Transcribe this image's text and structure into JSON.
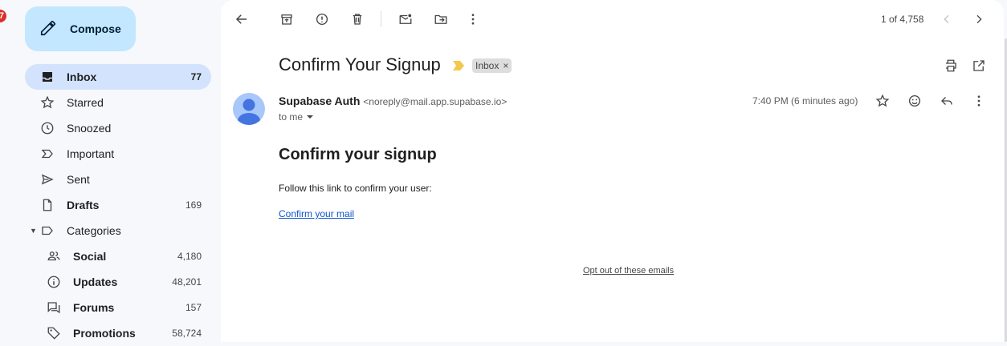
{
  "left_badge": "7",
  "compose": {
    "label": "Compose"
  },
  "sidebar": {
    "items": [
      {
        "label": "Inbox",
        "count": "77",
        "icon": "inbox-icon"
      },
      {
        "label": "Starred",
        "count": "",
        "icon": "star-icon"
      },
      {
        "label": "Snoozed",
        "count": "",
        "icon": "clock-icon"
      },
      {
        "label": "Important",
        "count": "",
        "icon": "important-icon"
      },
      {
        "label": "Sent",
        "count": "",
        "icon": "send-icon"
      },
      {
        "label": "Drafts",
        "count": "169",
        "icon": "draft-icon"
      },
      {
        "label": "Categories",
        "count": "",
        "icon": "label-icon"
      },
      {
        "label": "Social",
        "count": "4,180",
        "icon": "people-icon"
      },
      {
        "label": "Updates",
        "count": "48,201",
        "icon": "info-icon"
      },
      {
        "label": "Forums",
        "count": "157",
        "icon": "forum-icon"
      },
      {
        "label": "Promotions",
        "count": "58,724",
        "icon": "tag-icon"
      }
    ]
  },
  "toolbar": {
    "pager": "1 of 4,758",
    "icons": [
      "back-arrow-icon",
      "archive-icon",
      "report-spam-icon",
      "delete-icon",
      "mark-unread-icon",
      "move-to-icon",
      "more-vert-icon",
      "chevron-left-icon",
      "chevron-right-icon"
    ]
  },
  "email": {
    "subject": "Confirm Your Signup",
    "label_chip": "Inbox",
    "label_chip_close": "×",
    "sender_name": "Supabase Auth",
    "sender_email": "<noreply@mail.app.supabase.io>",
    "to": "to me",
    "time": "7:40 PM (6 minutes ago)",
    "body_heading": "Confirm your signup",
    "body_text": "Follow this link to confirm your user:",
    "body_link": "Confirm your mail",
    "optout": "Opt out of these emails"
  },
  "colors": {
    "background": "#f6f8fc",
    "compose_bg": "#c2e7ff",
    "active_nav": "#d3e3fd",
    "link": "#1155cc",
    "important_marker": "#f2c94c"
  }
}
